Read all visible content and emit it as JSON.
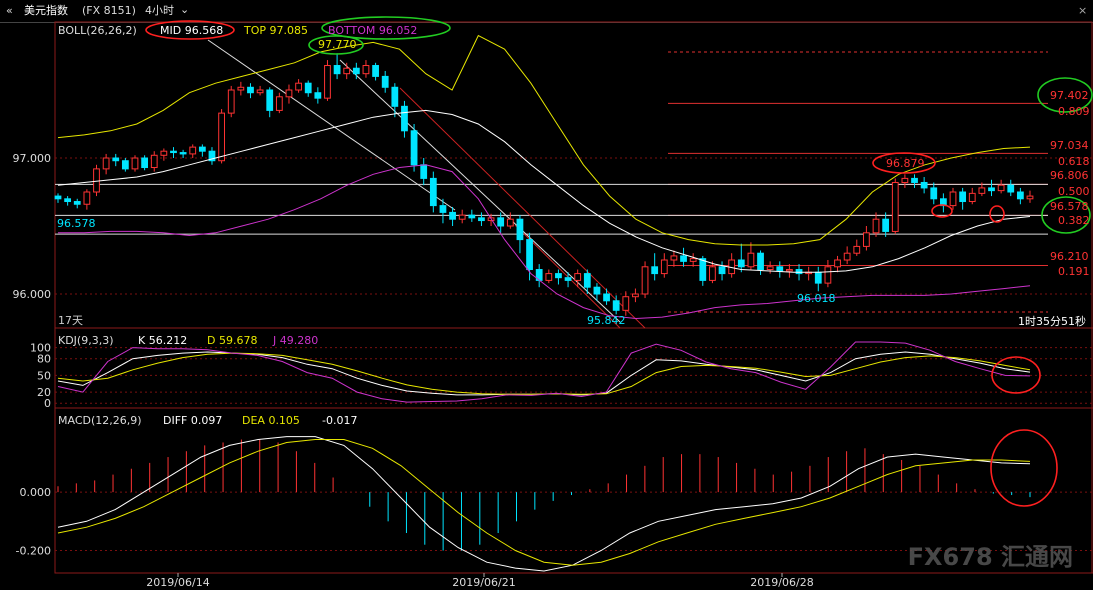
{
  "header": {
    "back_icon": "double-chevron-left-icon",
    "instrument": "美元指数",
    "code": "(FX 8151)",
    "period": "4小时",
    "dropdown_icon": "chevron-down-icon",
    "close_icon": "close-icon"
  },
  "colors": {
    "up": "#ff3333",
    "down": "#00e5ff",
    "mid": "#ffffff",
    "upper": "#e6e600",
    "lower": "#cc33cc",
    "fib": "#e03030",
    "grid": "#7a1010",
    "annot_red": "#ff2020",
    "annot_green": "#22cc22"
  },
  "boll": {
    "name": "BOLL(26,26,2)",
    "mid_label": "MID 96.568",
    "top_label": "TOP 97.085",
    "bottom_label": "BOTTOM 96.052"
  },
  "kdj": {
    "name": "KDJ(9,3,3)",
    "k_label": "K 56.212",
    "d_label": "D 59.678",
    "j_label": "J 49.280"
  },
  "macd": {
    "name": "MACD(12,26,9)",
    "diff_label": "DIFF 0.097",
    "dea_label": "DEA 0.105",
    "macd_label": "-0.017"
  },
  "main_annotations": {
    "high": "97.770",
    "low": "95.842",
    "low2": "96.018",
    "peak2": "96.879",
    "left_value": "96.578",
    "period_label": "17天",
    "countdown": "1时35分51秒"
  },
  "fib_levels": [
    {
      "price": "97.402",
      "ratio": "0.809"
    },
    {
      "price": "97.034",
      "ratio": "0.618"
    },
    {
      "price": "96.806",
      "ratio": "0.500"
    },
    {
      "price": "96.578",
      "ratio": "0.382"
    },
    {
      "price": "96.210",
      "ratio": "0.191"
    }
  ],
  "watermark": "FX678 汇通网",
  "chart_data": [
    {
      "type": "candlestick",
      "title": "美元指数 (FX 8151) 4小时",
      "y_ticks": [
        "97.000",
        "96.000"
      ],
      "x_ticks": [
        "2019/06/14",
        "2019/06/21",
        "2019/06/28"
      ],
      "ylim": [
        95.75,
        98.0
      ],
      "candles": [
        [
          96.72,
          96.7,
          96.74,
          96.67
        ],
        [
          96.7,
          96.68,
          96.72,
          96.65
        ],
        [
          96.68,
          96.66,
          96.7,
          96.63
        ],
        [
          96.66,
          96.75,
          96.77,
          96.62
        ],
        [
          96.75,
          96.92,
          96.95,
          96.72
        ],
        [
          96.92,
          97.0,
          97.03,
          96.88
        ],
        [
          97.0,
          96.98,
          97.03,
          96.94
        ],
        [
          96.98,
          96.92,
          97.0,
          96.9
        ],
        [
          96.92,
          97.0,
          97.02,
          96.9
        ],
        [
          97.0,
          96.93,
          97.02,
          96.91
        ],
        [
          96.93,
          97.02,
          97.05,
          96.9
        ],
        [
          97.02,
          97.05,
          97.07,
          96.98
        ],
        [
          97.05,
          97.04,
          97.08,
          97.0
        ],
        [
          97.04,
          97.03,
          97.06,
          97.0
        ],
        [
          97.03,
          97.08,
          97.1,
          97.0
        ],
        [
          97.08,
          97.05,
          97.1,
          97.01
        ],
        [
          97.05,
          96.98,
          97.08,
          96.95
        ],
        [
          96.98,
          97.33,
          97.36,
          96.96
        ],
        [
          97.33,
          97.5,
          97.53,
          97.3
        ],
        [
          97.5,
          97.52,
          97.56,
          97.46
        ],
        [
          97.52,
          97.48,
          97.55,
          97.44
        ],
        [
          97.48,
          97.5,
          97.53,
          97.46
        ],
        [
          97.5,
          97.35,
          97.52,
          97.3
        ],
        [
          97.35,
          97.45,
          97.48,
          97.33
        ],
        [
          97.45,
          97.5,
          97.54,
          97.4
        ],
        [
          97.5,
          97.55,
          97.58,
          97.48
        ],
        [
          97.55,
          97.48,
          97.57,
          97.45
        ],
        [
          97.48,
          97.44,
          97.52,
          97.4
        ],
        [
          97.44,
          97.68,
          97.72,
          97.42
        ],
        [
          97.68,
          97.62,
          97.77,
          97.58
        ],
        [
          97.62,
          97.66,
          97.7,
          97.58
        ],
        [
          97.66,
          97.62,
          97.7,
          97.58
        ],
        [
          97.62,
          97.68,
          97.72,
          97.59
        ],
        [
          97.68,
          97.6,
          97.7,
          97.57
        ],
        [
          97.6,
          97.52,
          97.64,
          97.48
        ],
        [
          97.52,
          97.38,
          97.55,
          97.3
        ],
        [
          97.38,
          97.2,
          97.42,
          97.15
        ],
        [
          97.2,
          96.95,
          97.25,
          96.9
        ],
        [
          96.95,
          96.85,
          97.0,
          96.8
        ],
        [
          96.85,
          96.65,
          96.9,
          96.6
        ],
        [
          96.65,
          96.6,
          96.7,
          96.52
        ],
        [
          96.6,
          96.55,
          96.64,
          96.5
        ],
        [
          96.55,
          96.58,
          96.62,
          96.52
        ],
        [
          96.58,
          96.56,
          96.62,
          96.53
        ],
        [
          96.56,
          96.54,
          96.6,
          96.5
        ],
        [
          96.54,
          96.56,
          96.59,
          96.5
        ],
        [
          96.56,
          96.5,
          96.6,
          96.45
        ],
        [
          96.5,
          96.55,
          96.6,
          96.48
        ],
        [
          96.55,
          96.4,
          96.58,
          96.3
        ],
        [
          96.4,
          96.18,
          96.45,
          96.1
        ],
        [
          96.18,
          96.1,
          96.22,
          96.05
        ],
        [
          96.1,
          96.15,
          96.18,
          96.08
        ],
        [
          96.15,
          96.12,
          96.18,
          96.07
        ],
        [
          96.12,
          96.1,
          96.16,
          96.05
        ],
        [
          96.1,
          96.15,
          96.18,
          96.05
        ],
        [
          96.15,
          96.05,
          96.18,
          96.0
        ],
        [
          96.05,
          96.0,
          96.08,
          95.95
        ],
        [
          96.0,
          95.95,
          96.04,
          95.92
        ],
        [
          95.95,
          95.88,
          95.99,
          95.85
        ],
        [
          95.88,
          95.98,
          96.02,
          95.84
        ],
        [
          95.98,
          96.0,
          96.04,
          95.94
        ],
        [
          96.0,
          96.2,
          96.24,
          95.97
        ],
        [
          96.2,
          96.15,
          96.3,
          96.1
        ],
        [
          96.15,
          96.25,
          96.3,
          96.12
        ],
        [
          96.25,
          96.28,
          96.32,
          96.2
        ],
        [
          96.28,
          96.24,
          96.34,
          96.2
        ],
        [
          96.24,
          96.26,
          96.3,
          96.2
        ],
        [
          96.26,
          96.1,
          96.28,
          96.06
        ],
        [
          96.1,
          96.2,
          96.24,
          96.08
        ],
        [
          96.2,
          96.15,
          96.24,
          96.1
        ],
        [
          96.15,
          96.25,
          96.3,
          96.12
        ],
        [
          96.25,
          96.2,
          96.37,
          96.16
        ],
        [
          96.2,
          96.3,
          96.38,
          96.18
        ],
        [
          96.3,
          96.18,
          96.32,
          96.14
        ],
        [
          96.18,
          96.2,
          96.24,
          96.15
        ],
        [
          96.2,
          96.17,
          96.24,
          96.12
        ],
        [
          96.17,
          96.18,
          96.22,
          96.12
        ],
        [
          96.18,
          96.15,
          96.22,
          96.1
        ],
        [
          96.15,
          96.16,
          96.2,
          96.1
        ],
        [
          96.16,
          96.08,
          96.2,
          96.02
        ],
        [
          96.08,
          96.2,
          96.25,
          96.05
        ],
        [
          96.2,
          96.25,
          96.28,
          96.16
        ],
        [
          96.25,
          96.3,
          96.35,
          96.22
        ],
        [
          96.3,
          96.35,
          96.4,
          96.28
        ],
        [
          96.35,
          96.45,
          96.5,
          96.32
        ],
        [
          96.45,
          96.55,
          96.6,
          96.42
        ],
        [
          96.55,
          96.46,
          96.6,
          96.42
        ],
        [
          96.46,
          96.82,
          96.85,
          96.44
        ],
        [
          96.82,
          96.85,
          96.88,
          96.78
        ],
        [
          96.85,
          96.82,
          96.88,
          96.78
        ],
        [
          96.82,
          96.78,
          96.86,
          96.74
        ],
        [
          96.78,
          96.7,
          96.82,
          96.66
        ],
        [
          96.7,
          96.65,
          96.74,
          96.6
        ],
        [
          96.65,
          96.75,
          96.78,
          96.62
        ],
        [
          96.75,
          96.68,
          96.78,
          96.62
        ],
        [
          96.68,
          96.74,
          96.78,
          96.66
        ],
        [
          96.74,
          96.78,
          96.82,
          96.72
        ],
        [
          96.78,
          96.76,
          96.84,
          96.72
        ],
        [
          96.76,
          96.8,
          96.84,
          96.74
        ],
        [
          96.8,
          96.75,
          96.84,
          96.72
        ],
        [
          96.75,
          96.7,
          96.78,
          96.66
        ],
        [
          96.7,
          96.72,
          96.76,
          96.67
        ]
      ],
      "series": [
        {
          "name": "MID",
          "values": [
            96.8,
            96.82,
            96.84,
            96.86,
            96.9,
            96.95,
            97.0,
            97.05,
            97.1,
            97.15,
            97.2,
            97.25,
            97.3,
            97.33,
            97.35,
            97.32,
            97.25,
            97.12,
            96.95,
            96.8,
            96.65,
            96.52,
            96.42,
            96.34,
            96.28,
            96.22,
            96.18,
            96.17,
            96.16,
            96.16,
            96.17,
            96.2,
            96.26,
            96.34,
            96.43,
            96.5,
            96.55,
            96.57
          ]
        },
        {
          "name": "TOP",
          "values": [
            97.15,
            97.17,
            97.2,
            97.25,
            97.35,
            97.48,
            97.55,
            97.6,
            97.65,
            97.7,
            97.78,
            97.82,
            97.85,
            97.8,
            97.62,
            97.5,
            97.9,
            97.8,
            97.55,
            97.25,
            96.95,
            96.72,
            96.55,
            96.45,
            96.4,
            96.37,
            96.36,
            96.36,
            96.37,
            96.4,
            96.55,
            96.75,
            96.88,
            96.95,
            97.0,
            97.04,
            97.07,
            97.08
          ]
        },
        {
          "name": "BOTTOM",
          "values": [
            96.45,
            96.45,
            96.46,
            96.46,
            96.45,
            96.43,
            96.45,
            96.5,
            96.55,
            96.62,
            96.7,
            96.8,
            96.88,
            96.93,
            96.95,
            96.9,
            96.7,
            96.4,
            96.15,
            96.0,
            95.9,
            95.84,
            95.82,
            95.83,
            95.86,
            95.9,
            95.92,
            95.93,
            95.95,
            95.97,
            95.98,
            95.99,
            95.99,
            95.99,
            96.0,
            96.02,
            96.04,
            96.06
          ]
        }
      ]
    },
    {
      "type": "line",
      "title": "KDJ(9,3,3)",
      "y_ticks": [
        "100",
        "80",
        "50",
        "20",
        "0"
      ],
      "ylim": [
        -5,
        110
      ],
      "series": [
        {
          "name": "K",
          "values": [
            40,
            32,
            55,
            80,
            86,
            90,
            92,
            90,
            88,
            82,
            70,
            62,
            45,
            32,
            22,
            18,
            15,
            15,
            16,
            16,
            17,
            15,
            18,
            50,
            78,
            76,
            70,
            65,
            60,
            50,
            40,
            55,
            80,
            88,
            92,
            88,
            80,
            72,
            62,
            56
          ]
        },
        {
          "name": "D",
          "values": [
            45,
            40,
            45,
            60,
            72,
            82,
            88,
            90,
            89,
            86,
            78,
            70,
            58,
            45,
            33,
            25,
            20,
            17,
            16,
            16,
            17,
            16,
            17,
            30,
            55,
            66,
            68,
            66,
            63,
            56,
            48,
            50,
            62,
            74,
            82,
            85,
            82,
            76,
            68,
            60
          ]
        },
        {
          "name": "J",
          "values": [
            30,
            20,
            75,
            100,
            98,
            98,
            96,
            90,
            86,
            75,
            55,
            45,
            20,
            8,
            2,
            3,
            4,
            8,
            15,
            14,
            18,
            12,
            20,
            90,
            106,
            95,
            74,
            62,
            55,
            38,
            25,
            65,
            110,
            110,
            108,
            95,
            75,
            62,
            50,
            49
          ]
        }
      ]
    },
    {
      "type": "bar",
      "title": "MACD(12,26,9)",
      "y_ticks": [
        "0.000",
        "-0.200"
      ],
      "ylim": [
        -0.27,
        0.24
      ],
      "histogram": [
        0.02,
        0.03,
        0.04,
        0.06,
        0.08,
        0.1,
        0.12,
        0.14,
        0.16,
        0.17,
        0.18,
        0.18,
        0.17,
        0.14,
        0.1,
        0.05,
        0.0,
        -0.05,
        -0.1,
        -0.14,
        -0.18,
        -0.2,
        -0.2,
        -0.18,
        -0.14,
        -0.1,
        -0.06,
        -0.03,
        -0.01,
        0.01,
        0.03,
        0.06,
        0.09,
        0.12,
        0.13,
        0.13,
        0.12,
        0.1,
        0.08,
        0.06,
        0.07,
        0.09,
        0.12,
        0.14,
        0.15,
        0.13,
        0.11,
        0.09,
        0.06,
        0.03,
        0.01,
        -0.005,
        -0.01,
        -0.017
      ],
      "series": [
        {
          "name": "DIFF",
          "values": [
            -0.12,
            -0.1,
            -0.06,
            0.0,
            0.06,
            0.12,
            0.16,
            0.18,
            0.19,
            0.19,
            0.16,
            0.08,
            -0.02,
            -0.12,
            -0.19,
            -0.24,
            -0.26,
            -0.27,
            -0.25,
            -0.2,
            -0.14,
            -0.1,
            -0.08,
            -0.06,
            -0.05,
            -0.04,
            -0.02,
            0.02,
            0.08,
            0.12,
            0.13,
            0.12,
            0.11,
            0.1,
            0.097
          ]
        },
        {
          "name": "DEA",
          "values": [
            -0.14,
            -0.12,
            -0.09,
            -0.05,
            0.0,
            0.05,
            0.1,
            0.14,
            0.17,
            0.18,
            0.18,
            0.15,
            0.09,
            0.01,
            -0.07,
            -0.14,
            -0.2,
            -0.24,
            -0.25,
            -0.24,
            -0.21,
            -0.17,
            -0.14,
            -0.11,
            -0.09,
            -0.07,
            -0.05,
            -0.02,
            0.02,
            0.06,
            0.09,
            0.1,
            0.11,
            0.11,
            0.105
          ]
        }
      ]
    }
  ]
}
